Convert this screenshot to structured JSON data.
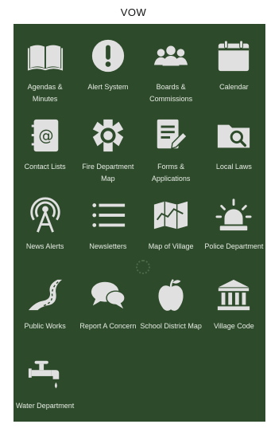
{
  "header": {
    "title": "VOW"
  },
  "tiles": [
    {
      "label": "Agendas & Minutes",
      "icon": "book-icon"
    },
    {
      "label": "Alert System",
      "icon": "exclamation-icon"
    },
    {
      "label": "Boards & Commissions",
      "icon": "people-icon"
    },
    {
      "label": "Calendar",
      "icon": "calendar-icon"
    },
    {
      "label": "Contact Lists",
      "icon": "address-book-icon"
    },
    {
      "label": "Fire Department Map",
      "icon": "fire-badge-icon"
    },
    {
      "label": "Forms & Applications",
      "icon": "form-pencil-icon"
    },
    {
      "label": "Local Laws",
      "icon": "folder-search-icon"
    },
    {
      "label": "News Alerts",
      "icon": "broadcast-tower-icon"
    },
    {
      "label": "Newsletters",
      "icon": "list-icon"
    },
    {
      "label": "Map of Village",
      "icon": "map-icon"
    },
    {
      "label": "Police Department",
      "icon": "siren-icon"
    },
    {
      "label": "Public Works",
      "icon": "road-icon"
    },
    {
      "label": "Report A Concern",
      "icon": "chat-bubbles-icon"
    },
    {
      "label": "School District Map",
      "icon": "apple-icon"
    },
    {
      "label": "Village Code",
      "icon": "courthouse-icon"
    },
    {
      "label": "Water Department",
      "icon": "faucet-icon"
    }
  ],
  "colors": {
    "panel": "#2d4a2a",
    "icon": "#e0e0e0",
    "label": "#e6ece4"
  }
}
